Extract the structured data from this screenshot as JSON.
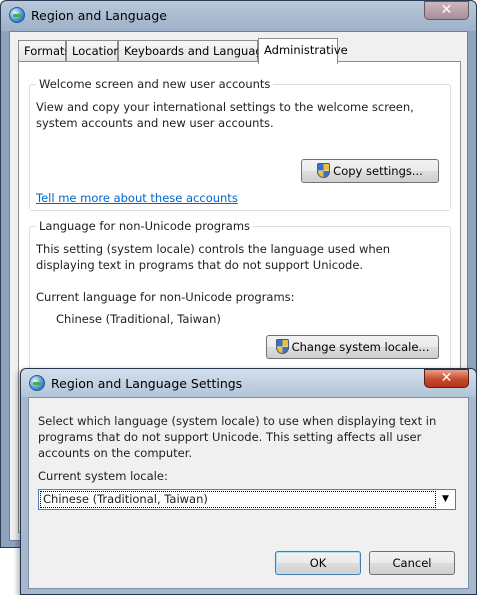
{
  "main_window": {
    "title": "Region and Language",
    "close_glyph": "✕",
    "tabs": [
      {
        "label": "Formats"
      },
      {
        "label": "Location"
      },
      {
        "label": "Keyboards and Languages"
      },
      {
        "label": "Administrative"
      }
    ],
    "active_tab": "Administrative",
    "welcome_group": {
      "label": "Welcome screen and new user accounts",
      "description": "View and copy your international settings to the welcome screen, system accounts and new user accounts.",
      "copy_button": "Copy settings...",
      "link": "Tell me more about these accounts"
    },
    "unicode_group": {
      "label": "Language for non-Unicode programs",
      "description": "This setting (system locale) controls the language used when displaying text in programs that do not support Unicode.",
      "current_label": "Current language for non-Unicode programs:",
      "current_value": "Chinese (Traditional, Taiwan)",
      "change_button": "Change system locale..."
    }
  },
  "dialog": {
    "title": "Region and Language Settings",
    "close_glyph": "✕",
    "description": "Select which language (system locale) to use when displaying text in programs that do not support Unicode. This setting affects all user accounts on the computer.",
    "locale_label": "Current system locale:",
    "locale_value": "Chinese (Traditional, Taiwan)",
    "dropdown_glyph": "▼",
    "ok_button": "OK",
    "cancel_button": "Cancel"
  },
  "icons": {
    "window_icon": "region-globe-icon",
    "uac_icon": "uac-shield-icon"
  },
  "colors": {
    "link": "#0066cc",
    "close_red": "#c64a2c",
    "title_bar": "#b3c4d8"
  }
}
